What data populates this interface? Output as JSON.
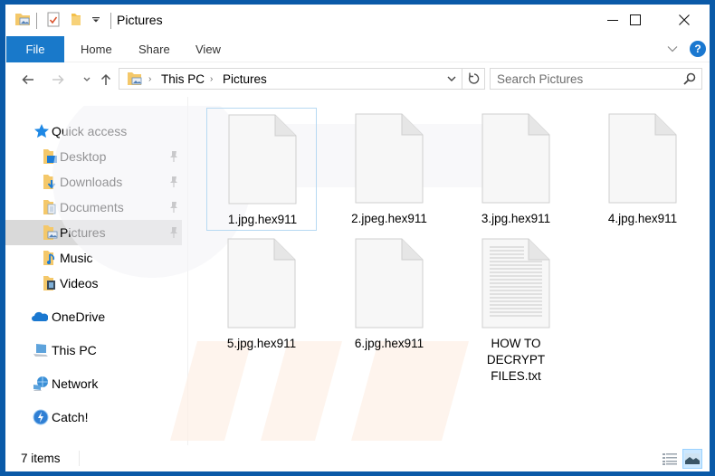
{
  "window": {
    "title": "Pictures",
    "controls": {
      "minimize": "—",
      "maximize": "☐",
      "close": "✕"
    }
  },
  "quick_access_toolbar": {
    "icons": [
      "pictures-folder-icon",
      "properties-icon",
      "new-folder-icon",
      "customize-dropdown-icon"
    ]
  },
  "ribbon": {
    "file_tab": "File",
    "tabs": [
      "Home",
      "Share",
      "View"
    ],
    "help": "?"
  },
  "address_bar": {
    "breadcrumb": [
      "This PC",
      "Pictures"
    ],
    "search_placeholder": "Search Pictures"
  },
  "nav_pane": {
    "quick_access": "Quick access",
    "quick_items": [
      {
        "label": "Desktop",
        "icon": "desktop-folder-icon",
        "pinned": true
      },
      {
        "label": "Downloads",
        "icon": "downloads-folder-icon",
        "pinned": true
      },
      {
        "label": "Documents",
        "icon": "documents-folder-icon",
        "pinned": true
      },
      {
        "label": "Pictures",
        "icon": "pictures-folder-icon",
        "pinned": true,
        "selected": true
      },
      {
        "label": "Music",
        "icon": "music-folder-icon",
        "pinned": false
      },
      {
        "label": "Videos",
        "icon": "videos-folder-icon",
        "pinned": false
      }
    ],
    "roots": [
      {
        "label": "OneDrive",
        "icon": "onedrive-icon"
      },
      {
        "label": "This PC",
        "icon": "this-pc-icon"
      },
      {
        "label": "Network",
        "icon": "network-icon"
      },
      {
        "label": "Catch!",
        "icon": "catch-icon"
      }
    ]
  },
  "files": [
    {
      "name": "1.jpg.hex911",
      "type": "blank",
      "focused": true
    },
    {
      "name": "2.jpeg.hex911",
      "type": "blank"
    },
    {
      "name": "3.jpg.hex911",
      "type": "blank"
    },
    {
      "name": "4.jpg.hex911",
      "type": "blank"
    },
    {
      "name": "5.jpg.hex911",
      "type": "blank"
    },
    {
      "name": "6.jpg.hex911",
      "type": "blank"
    },
    {
      "name_lines": [
        "HOW TO",
        "DECRYPT",
        "FILES.txt"
      ],
      "name": "HOW TO DECRYPT FILES.txt",
      "type": "text"
    }
  ],
  "status_bar": {
    "item_count": "7 items",
    "views": [
      "details-view-icon",
      "large-icons-view-icon"
    ],
    "active_view": "large-icons-view-icon"
  },
  "colors": {
    "accent": "#1979ca",
    "frame": "#0a5aa8",
    "selection": "#d9d9d9",
    "focus_border": "#b7d9f2"
  }
}
